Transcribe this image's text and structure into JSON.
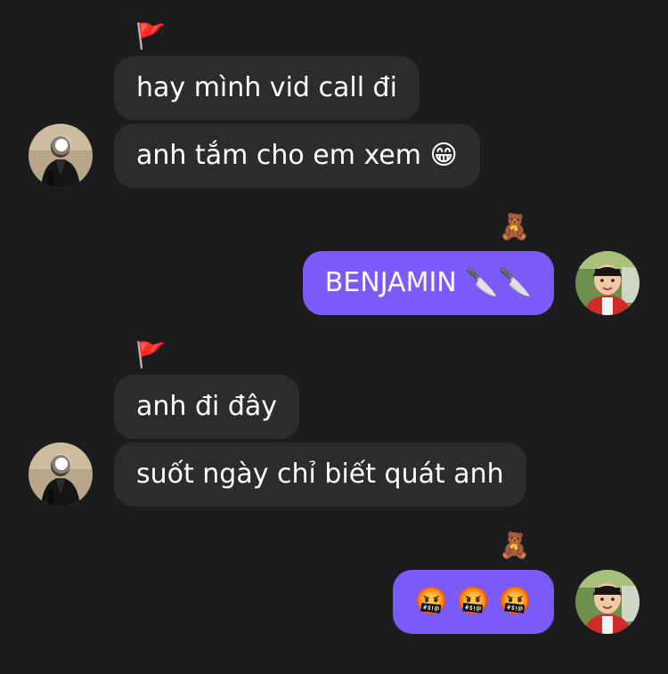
{
  "messages": [
    {
      "sender": "other",
      "reaction": "🚩",
      "bubbles": [
        "hay mình vid call đi",
        "anh tắm cho em xem 😁"
      ]
    },
    {
      "sender": "me",
      "reaction": "🧸",
      "bubbles": [
        "BENJAMIN 🔪🔪"
      ]
    },
    {
      "sender": "other",
      "reaction": "🚩",
      "bubbles": [
        "anh đi đây",
        "suốt ngày chỉ biết quát anh"
      ]
    },
    {
      "sender": "me",
      "reaction": "🧸",
      "bubbles": [
        "🤬 🤬 🤬"
      ]
    }
  ],
  "colors": {
    "background": "#1c1c1e",
    "incoming_bubble": "#2c2c2e",
    "outgoing_bubble": "#7a5af8",
    "text": "#ffffff"
  },
  "icons": {
    "other_avatar": "person-in-dark-jacket-avatar",
    "me_avatar": "child-portrait-avatar"
  }
}
